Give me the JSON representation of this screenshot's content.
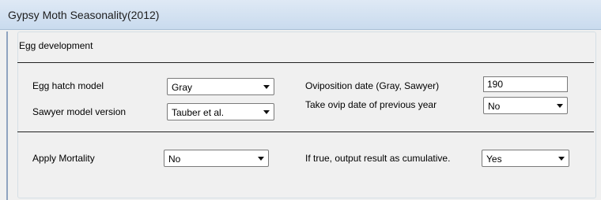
{
  "window": {
    "title": "Gypsy Moth Seasonality(2012)"
  },
  "group": {
    "title": "Egg development"
  },
  "fields": {
    "egg_hatch_model": {
      "label": "Egg hatch model",
      "value": "Gray"
    },
    "sawyer_model_version": {
      "label": "Sawyer model version",
      "value": "Tauber et al."
    },
    "oviposition_date": {
      "label": "Oviposition date (Gray, Sawyer)",
      "value": "190"
    },
    "take_ovip_date": {
      "label": "Take ovip date of previous year",
      "value": "No"
    },
    "apply_mortality": {
      "label": "Apply Mortality",
      "value": "No"
    },
    "output_cumulative": {
      "label": "If true, output result as cumulative.",
      "value": "Yes"
    }
  }
}
